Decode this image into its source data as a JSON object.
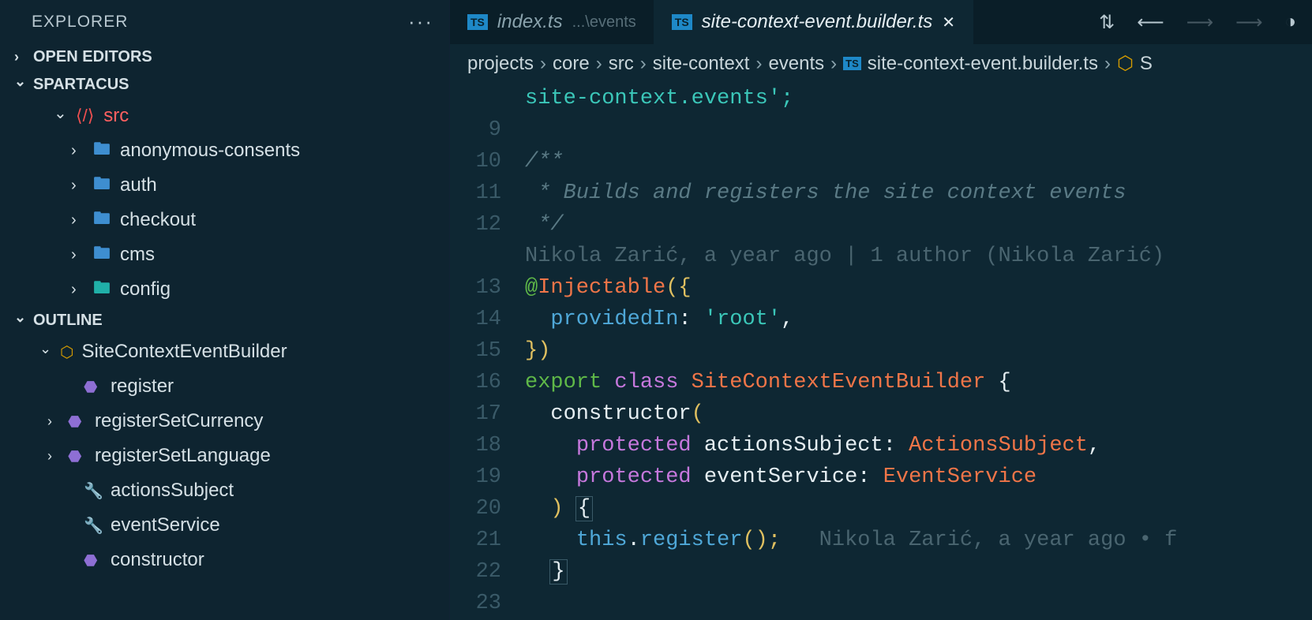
{
  "explorer": {
    "title": "EXPLORER",
    "openEditors": "OPEN EDITORS",
    "projectName": "SPARTACUS",
    "srcLabel": "src",
    "folders": [
      {
        "name": "anonymous-consents",
        "icon": "folder"
      },
      {
        "name": "auth",
        "icon": "folder-lock"
      },
      {
        "name": "checkout",
        "icon": "folder"
      },
      {
        "name": "cms",
        "icon": "folder"
      },
      {
        "name": "config",
        "icon": "folder-cfg"
      }
    ]
  },
  "outline": {
    "title": "OUTLINE",
    "root": "SiteContextEventBuilder",
    "items": [
      {
        "name": "register",
        "icon": "cube",
        "chev": false
      },
      {
        "name": "registerSetCurrency",
        "icon": "cube",
        "chev": true
      },
      {
        "name": "registerSetLanguage",
        "icon": "cube",
        "chev": true
      },
      {
        "name": "actionsSubject",
        "icon": "wrench",
        "chev": false
      },
      {
        "name": "eventService",
        "icon": "wrench",
        "chev": false
      },
      {
        "name": "constructor",
        "icon": "cube",
        "chev": false
      }
    ]
  },
  "tabs": [
    {
      "name": "index.ts",
      "path": "...\\events",
      "active": false
    },
    {
      "name": "site-context-event.builder.ts",
      "path": "",
      "active": true
    }
  ],
  "breadcrumbs": [
    "projects",
    "core",
    "src",
    "site-context",
    "events",
    "site-context-event.builder.ts",
    "S"
  ],
  "code": {
    "lineStart": 8,
    "topFragment": "site-context.events';",
    "commentOpen": "/**",
    "commentBody": " * Builds and registers the site context events",
    "commentClose": " */",
    "blame": "Nikola Zarić, a year ago | 1 author (Nikola Zarić)",
    "decoratorAt": "@",
    "decoratorName": "Injectable",
    "decoratorOpen": "({",
    "providedInKey": "providedIn",
    "providedInVal": "'root'",
    "decoratorClose": "})",
    "exportKw": "export",
    "classKw": "class",
    "className": "SiteContextEventBuilder",
    "braceOpen": " {",
    "ctor": "constructor",
    "ctorOpen": "(",
    "p1kw": "protected",
    "p1name": "actionsSubject",
    "p1type": "ActionsSubject",
    "p2kw": "protected",
    "p2name": "eventService",
    "p2type": "EventService",
    "ctorCloseParen": ") ",
    "ctorBraceOpen": "{",
    "thisKw": "this",
    "callName": "register",
    "callRest": "();",
    "inlineBlame": "   Nikola Zarić, a year ago • f",
    "ctorBraceClose": "}",
    "gutter": [
      "",
      "9",
      "10",
      "11",
      "12",
      "",
      "13",
      "14",
      "15",
      "16",
      "17",
      "18",
      "19",
      "20",
      "21",
      "22",
      "23"
    ]
  }
}
